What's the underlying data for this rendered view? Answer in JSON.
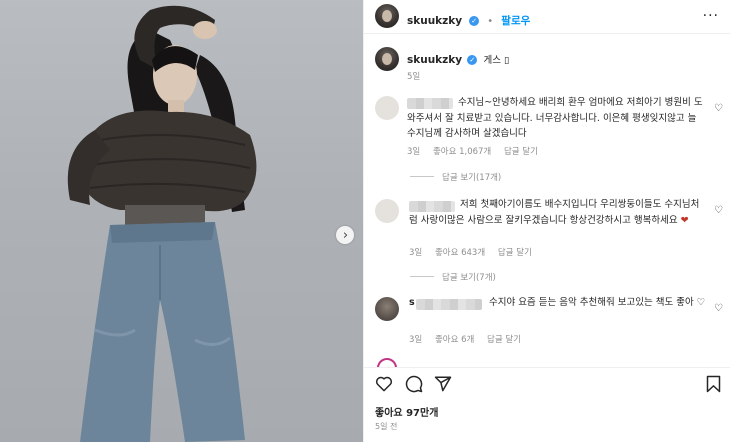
{
  "post": {
    "username": "skuukzky",
    "follow_label": "팔로우",
    "more_label": "···"
  },
  "caption": {
    "username": "skuukzky",
    "text": "게스 ▯",
    "time": "5일"
  },
  "comments": [
    {
      "text": "수지님~안녕하세요 배리희 환우 엄마에요 저희아기 병원비 도와주셔서 잘 치료받고 있습니다. 너무감사합니다. 이은혜 평생잊지않고 늘 수지님께 감사하며 살겠습니다",
      "time": "3일",
      "likes": "좋아요 1,067개",
      "reply_label": "답글 달기",
      "view_replies": "답글 보기(17개)"
    },
    {
      "text": "저희 첫째아기이름도 배수지입니다 우리쌍둥이들도 수지님처럼 사랑이많은 사람으로 잘키우겠습니다 항상건강하시고 행복하세요",
      "heart_emoji": "❤",
      "time": "3일",
      "likes": "좋아요 643개",
      "reply_label": "답글 달기",
      "view_replies": "답글 보기(7개)"
    },
    {
      "username_prefix": "s",
      "text": "수지야 요즘 듣는 음악 추천해줘 보고있는 책도 좋아",
      "heart_emoji": "♡",
      "time": "3일",
      "likes": "좋아요 6개",
      "reply_label": "답글 달기"
    }
  ],
  "actions": {
    "likes": "좋아요 97만개",
    "time": "5일 전"
  },
  "icons": {
    "more": "more-horizontal-icon",
    "verified": "verified-badge-icon",
    "heart": "heart-outline-icon",
    "comment": "comment-bubble-icon",
    "share": "paper-plane-icon",
    "save": "bookmark-icon",
    "next": "chevron-right-icon"
  },
  "colors": {
    "link_blue": "#0095f6",
    "verified_blue": "#3897f0",
    "muted_gray": "#8e8e8e",
    "text": "#262626",
    "heart_red": "#c0392b"
  }
}
